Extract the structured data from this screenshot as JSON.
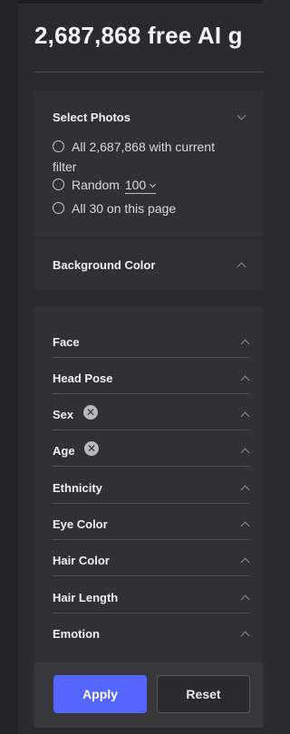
{
  "header": {
    "title": "2,687,868 free AI g"
  },
  "select_photos": {
    "title": "Select Photos",
    "options": [
      {
        "label": "All 2,687,868 with current filter",
        "checked": false
      },
      {
        "prefix": "Random",
        "value": "100",
        "checked": false
      },
      {
        "label": "All 30 on this page",
        "checked": false
      }
    ]
  },
  "background_color": {
    "title": "Background Color"
  },
  "filters": [
    {
      "label": "Face",
      "has_clear": false
    },
    {
      "label": "Head Pose",
      "has_clear": false
    },
    {
      "label": "Sex",
      "has_clear": true
    },
    {
      "label": "Age",
      "has_clear": true
    },
    {
      "label": "Ethnicity",
      "has_clear": false
    },
    {
      "label": "Eye Color",
      "has_clear": false
    },
    {
      "label": "Hair Color",
      "has_clear": false
    },
    {
      "label": "Hair Length",
      "has_clear": false
    },
    {
      "label": "Emotion",
      "has_clear": false
    }
  ],
  "actions": {
    "apply_label": "Apply",
    "reset_label": "Reset"
  },
  "icons": {
    "clear": "close-circle-icon",
    "expand": "chevron-up-icon",
    "collapse": "chevron-down-icon"
  },
  "colors": {
    "accent": "#5566ff",
    "background": "#2b2b2d",
    "panel": "#313134"
  }
}
